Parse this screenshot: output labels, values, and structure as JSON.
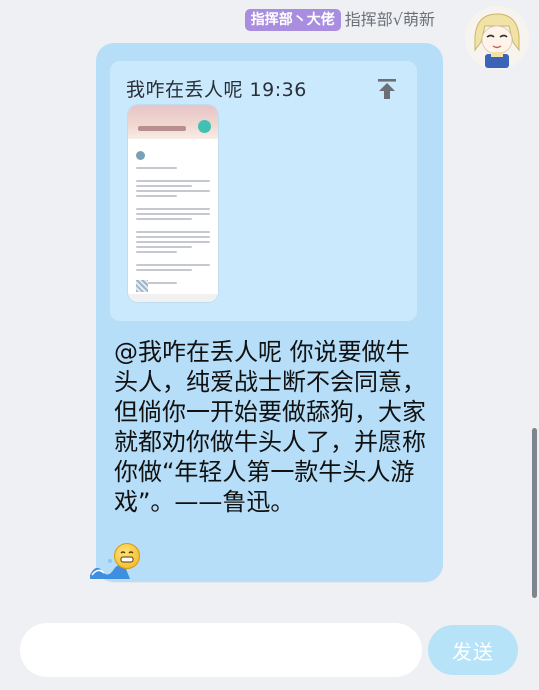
{
  "header": {
    "badge": "指挥部丶大佬",
    "sender": "指挥部√萌新"
  },
  "message": {
    "quote": {
      "author_time": "我咋在丢人呢 19:36"
    },
    "text": "@我咋在丢人呢 你说要做牛头人，纯爱战士断不会同意，但倘你一开始要做舔狗，大家就都劝你做牛头人了，并愿称你做“年轻人第一款牛头人游戏”。——鲁迅。"
  },
  "icons": {
    "pin": "pin-to-top-icon",
    "emoji": "grin-emoji-icon",
    "wave": "wave-decoration-icon",
    "avatar": "anime-girl-avatar"
  },
  "composer": {
    "input_value": "",
    "send_label": "发送"
  },
  "colors": {
    "bubble": "#b6def8",
    "quote_bg": "#cbe9fd",
    "badge": "#a98ee0",
    "send_button": "#b7e3f8"
  }
}
